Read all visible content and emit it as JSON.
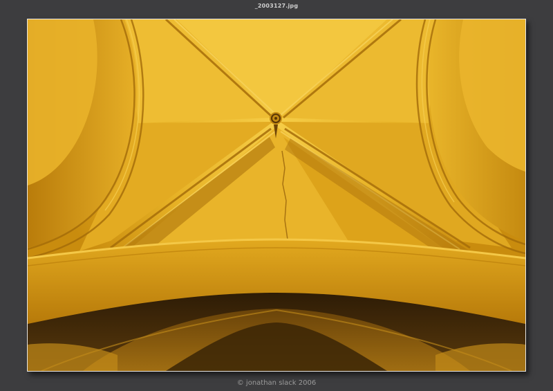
{
  "viewer": {
    "filename": "_2003127.jpg",
    "credit": "© jonathan slack 2006",
    "background_color": "#3d3d3f",
    "frame_color": "#e6e6e6"
  },
  "photo": {
    "subject-icon": "vaulted-ceiling-boss",
    "palette": {
      "highlight": "#f3c43a",
      "midtone": "#dba218",
      "shadow": "#9a6508",
      "deep": "#3b2307"
    }
  }
}
